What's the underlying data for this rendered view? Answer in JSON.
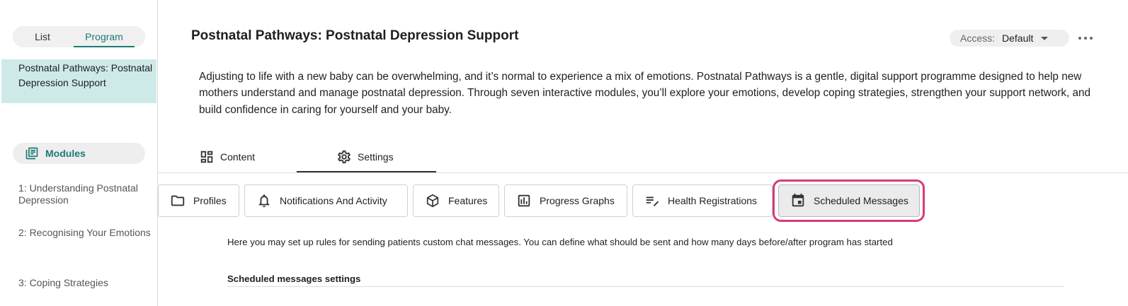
{
  "sidebar": {
    "toggle": {
      "list_label": "List",
      "program_label": "Program",
      "selected": "Program"
    },
    "program_item": {
      "label": "Postnatal Pathways: Postnatal Depression Support"
    },
    "modules_label": "Modules",
    "modules": [
      {
        "label": "1: Understanding Postnatal Depression"
      },
      {
        "label": "2: Recognising Your Emotions"
      },
      {
        "label": "3: Coping Strategies"
      }
    ]
  },
  "header": {
    "title": "Postnatal Pathways: Postnatal Depression Support",
    "access_label": "Access:",
    "access_value": "Default"
  },
  "description": "Adjusting to life with a new baby can be overwhelming, and it’s normal to experience a mix of emotions. Postnatal Pathways is a gentle, digital support programme designed to help new mothers understand and manage postnatal depression. Through seven interactive modules, you’ll explore your emotions, develop coping strategies, strengthen your support network, and build confidence in caring for yourself and your baby.",
  "main_tabs": [
    {
      "label": "Content",
      "icon": "dashboard-icon"
    },
    {
      "label": "Settings",
      "icon": "gear-icon",
      "active": true
    }
  ],
  "sub_tabs": [
    {
      "label": "Profiles",
      "icon": "folder-icon"
    },
    {
      "label": "Notifications And Activity",
      "icon": "bell-icon"
    },
    {
      "label": "Features",
      "icon": "cube-icon"
    },
    {
      "label": "Progress Graphs",
      "icon": "bar-chart-icon"
    },
    {
      "label": "Health Registrations",
      "icon": "edit-list-icon"
    },
    {
      "label": "Scheduled Messages",
      "icon": "calendar-icon",
      "active": true
    }
  ],
  "scheduled_messages": {
    "info": "Here you may set up rules for sending patients custom chat messages. You can define what should be sent and how many days before/after program has started",
    "section_title": "Scheduled messages settings"
  },
  "colors": {
    "accent": "#1b7a74",
    "selected_bg": "#cde9e8",
    "highlight": "#d63a7a"
  }
}
